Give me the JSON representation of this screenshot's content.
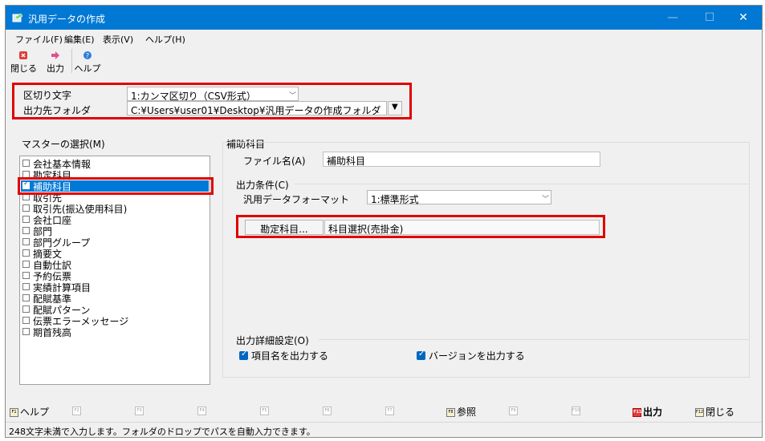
{
  "window": {
    "title": "汎用データの作成",
    "minimize": "—",
    "maximize": "☐",
    "close": "✕"
  },
  "menu": [
    {
      "label": "ファイル(F)"
    },
    {
      "label": "編集(E)"
    },
    {
      "label": "表示(V)"
    },
    {
      "label": "ヘルプ(H)"
    }
  ],
  "toolbar": {
    "close_label": "閉じる",
    "output_label": "出力",
    "help_label": "ヘルプ",
    "close_icon": "close-icon",
    "output_icon": "arrow-right-icon",
    "help_icon": "help-icon"
  },
  "settings": {
    "delimiter_label": "区切り文字",
    "delimiter_value": "1:カンマ区切り（CSV形式）",
    "folder_label": "出力先フォルダ",
    "folder_value": "C:¥Users¥user01¥Desktop¥汎用データの作成フォルダ"
  },
  "master": {
    "title": "マスターの選択(M)",
    "items": [
      {
        "label": "会社基本情報",
        "checked": false
      },
      {
        "label": "勘定科目",
        "checked": false
      },
      {
        "label": "補助科目",
        "checked": true
      },
      {
        "label": "取引先",
        "checked": false
      },
      {
        "label": "取引先(振込使用科目)",
        "checked": false
      },
      {
        "label": "会社口座",
        "checked": false
      },
      {
        "label": "部門",
        "checked": false
      },
      {
        "label": "部門グループ",
        "checked": false
      },
      {
        "label": "摘要文",
        "checked": false
      },
      {
        "label": "自動仕訳",
        "checked": false
      },
      {
        "label": "予約伝票",
        "checked": false
      },
      {
        "label": "実績計算項目",
        "checked": false
      },
      {
        "label": "配賦基準",
        "checked": false
      },
      {
        "label": "配賦パターン",
        "checked": false
      },
      {
        "label": "伝票エラーメッセージ",
        "checked": false
      },
      {
        "label": "期首残高",
        "checked": false
      }
    ]
  },
  "detail": {
    "title": "補助科目",
    "filename_label": "ファイル名(A)",
    "filename_value": "補助科目",
    "output_cond_title": "出力条件(C)",
    "format_label": "汎用データフォーマット",
    "format_value": "1:標準形式",
    "account_button": "勘定科目...",
    "account_value": "科目選択(売掛金)",
    "output_detail_title": "出力詳細設定(O)",
    "opt_item_name": "項目名を出力する",
    "opt_version": "バージョンを出力する"
  },
  "fkeys": [
    {
      "key": "F1",
      "label": "ヘルプ",
      "enabled": true
    },
    {
      "key": "F2",
      "label": "",
      "enabled": false
    },
    {
      "key": "F3",
      "label": "",
      "enabled": false
    },
    {
      "key": "F4",
      "label": "",
      "enabled": false
    },
    {
      "key": "F5",
      "label": "",
      "enabled": false
    },
    {
      "key": "F6",
      "label": "",
      "enabled": false
    },
    {
      "key": "F7",
      "label": "",
      "enabled": false
    },
    {
      "key": "F8",
      "label": "参照",
      "enabled": true
    },
    {
      "key": "F9",
      "label": "",
      "enabled": false
    },
    {
      "key": "F10",
      "label": "",
      "enabled": false
    },
    {
      "key": "F11",
      "label": "出力",
      "enabled": true
    },
    {
      "key": "F12",
      "label": "閉じる",
      "enabled": true
    }
  ],
  "status": {
    "text": "248文字未満で入力します。フォルダのドロップでパスを自動入力できます。"
  },
  "colors": {
    "titlebar": "#0078d4",
    "highlight": "#e00000",
    "selection": "#0078d7",
    "checkbox": "#0067c0"
  }
}
